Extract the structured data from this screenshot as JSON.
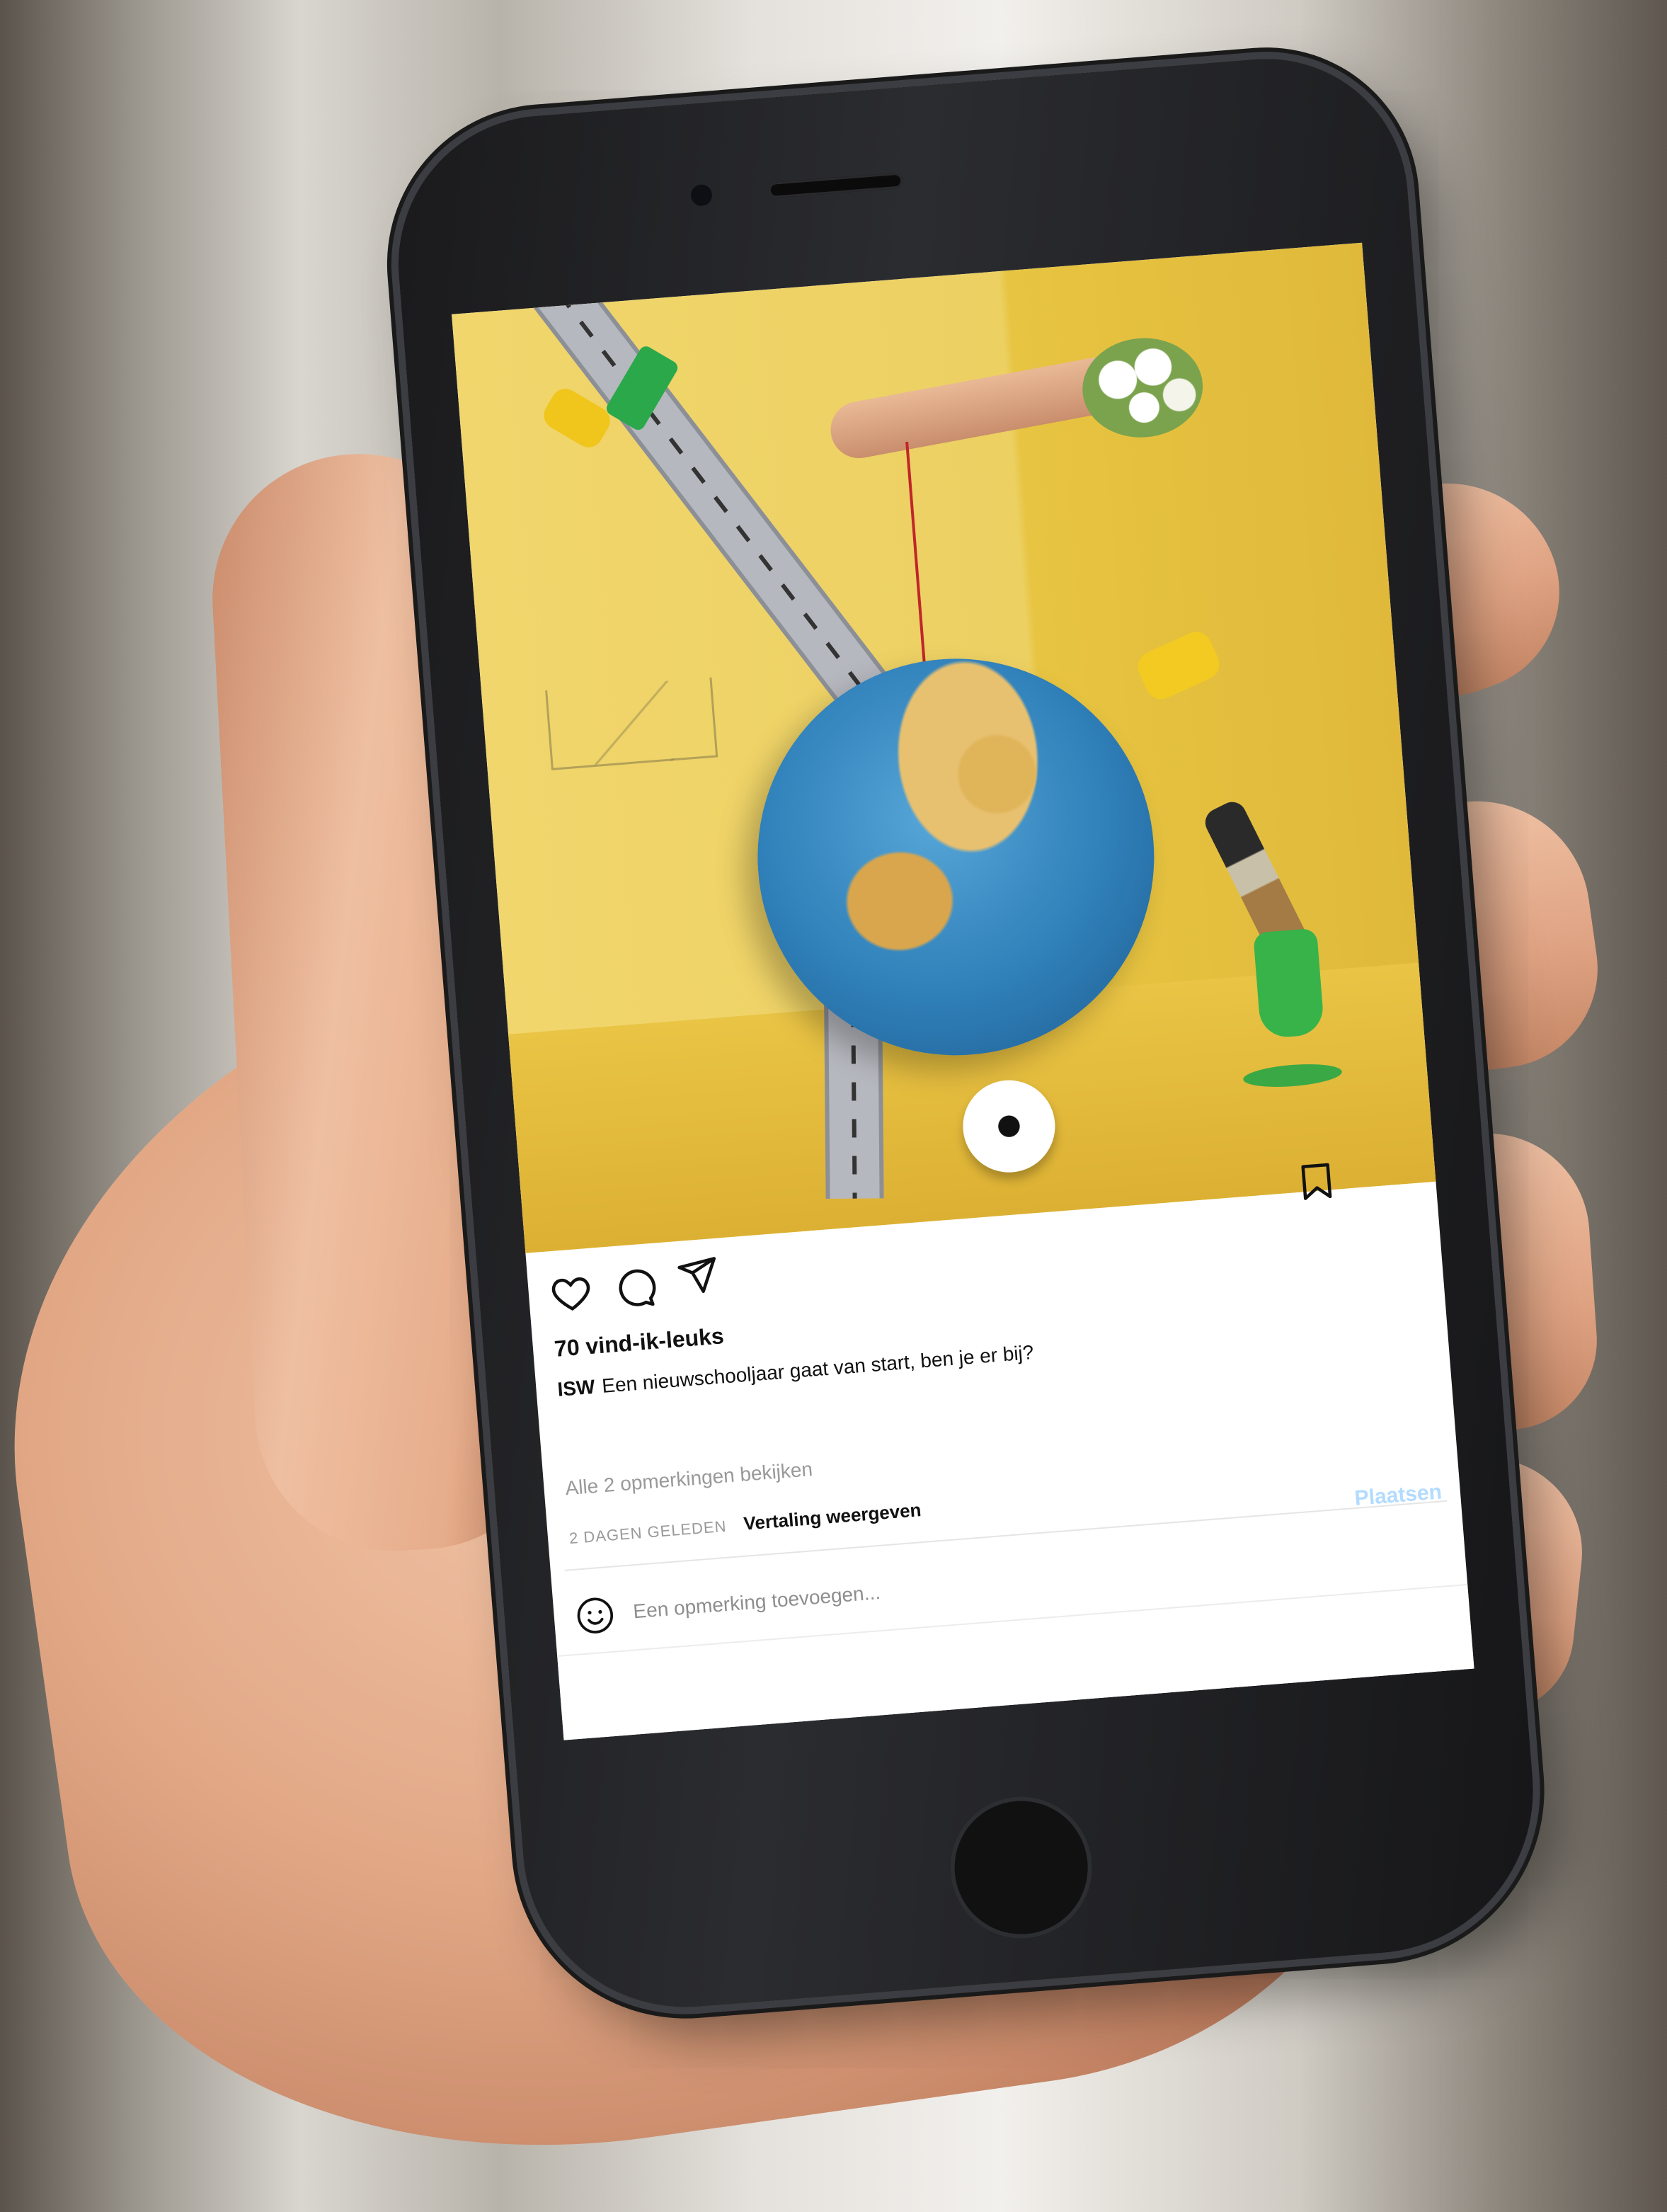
{
  "post": {
    "likes": "70 vind-ik-leuks",
    "caption_user": "ISW",
    "caption_text": "Een nieuwschooljaar gaat van start, ben je er bij?",
    "view_comments": "Alle 2 opmerkingen bekijken",
    "timestamp": "2 DAGEN GELEDEN",
    "translate": "Vertaling weergeven"
  },
  "comment": {
    "placeholder": "Een opmerking toevoegen...",
    "post_label": "Plaatsen"
  },
  "icons": {
    "like": "heart-icon",
    "comment": "comment-icon",
    "share": "send-icon",
    "save": "bookmark-icon",
    "emoji": "smiley-icon"
  },
  "colors": {
    "photo_background": "#ecd062",
    "post_button_disabled": "#b3dbff",
    "text": "#111111",
    "muted_text": "#999999"
  }
}
